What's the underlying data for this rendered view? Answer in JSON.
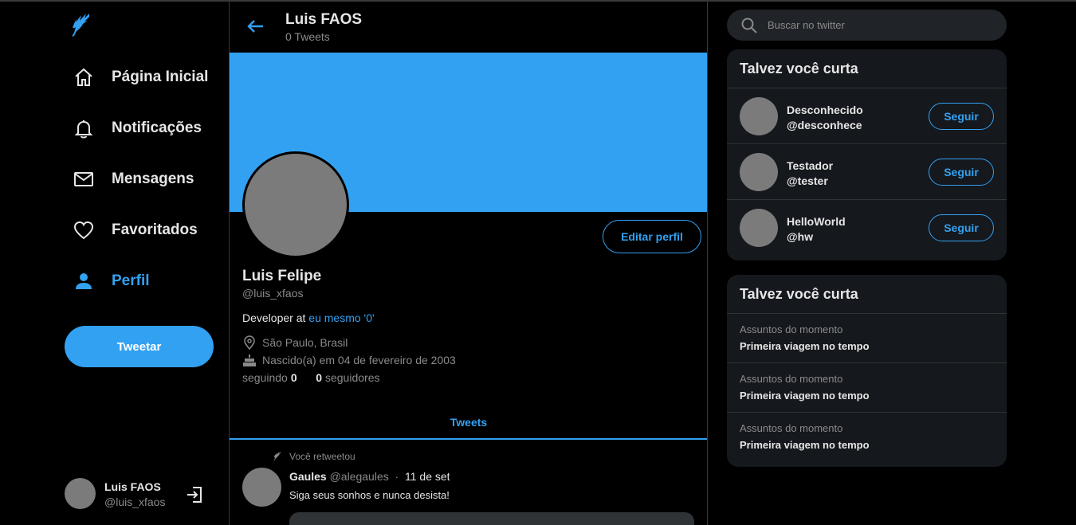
{
  "sidebar": {
    "logo": "bird-icon",
    "nav": [
      {
        "label": "Página Inicial",
        "icon": "home-icon"
      },
      {
        "label": "Notificações",
        "icon": "bell-icon"
      },
      {
        "label": "Mensagens",
        "icon": "mail-icon"
      },
      {
        "label": "Favoritados",
        "icon": "heart-icon"
      },
      {
        "label": "Perfil",
        "icon": "user-icon",
        "active": true
      }
    ],
    "tweet_button": "Tweetar",
    "account": {
      "name": "Luis FAOS",
      "handle": "@luis_xfaos"
    }
  },
  "header": {
    "title": "Luis FAOS",
    "subtitle": "0 Tweets"
  },
  "profile": {
    "edit_button": "Editar perfil",
    "name": "Luis Felipe",
    "handle": "@luis_xfaos",
    "bio_prefix": "Developer at ",
    "bio_link": "eu mesmo '0'",
    "location": "São Paulo, Brasil",
    "birth": "Nascido(a) em 04 de fevereiro de 2003",
    "following_label": "seguindo",
    "following_count": "0",
    "followers_count": "0",
    "followers_label": "seguidores"
  },
  "tabs": {
    "tweets": "Tweets"
  },
  "tweet": {
    "retweet_label": "Você retweetou",
    "author": "Gaules",
    "handle": "@alegaules",
    "separator": "·",
    "date": "11 de set",
    "text": "Siga seus sonhos e nunca desista!"
  },
  "search": {
    "placeholder": "Buscar no twitter"
  },
  "who_to_follow": {
    "title": "Talvez você curta",
    "follow_label": "Seguir",
    "users": [
      {
        "name": "Desconhecido",
        "handle": "@desconhece"
      },
      {
        "name": "Testador",
        "handle": "@tester"
      },
      {
        "name": "HelloWorld",
        "handle": "@hw"
      }
    ]
  },
  "trends": {
    "title": "Talvez você curta",
    "items": [
      {
        "category": "Assuntos do momento",
        "topic": "Primeira viagem no tempo"
      },
      {
        "category": "Assuntos do momento",
        "topic": "Primeira viagem no tempo"
      },
      {
        "category": "Assuntos do momento",
        "topic": "Primeira viagem no tempo"
      }
    ]
  },
  "colors": {
    "accent": "#33a1f2",
    "background": "#000000",
    "card": "#15181c",
    "avatar": "#7b7b7b"
  }
}
